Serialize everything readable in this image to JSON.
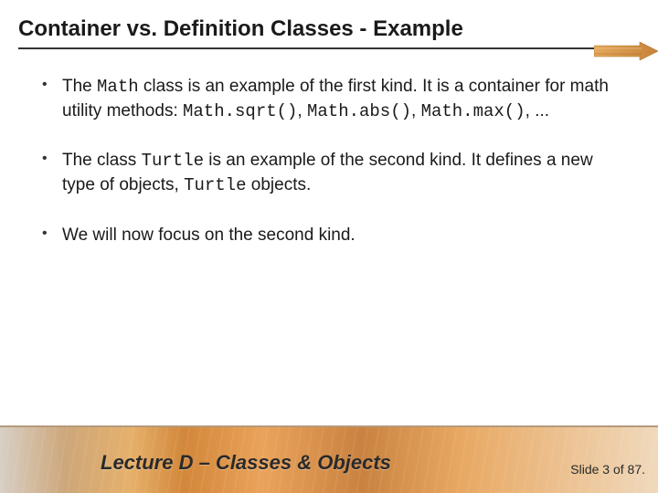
{
  "title": "Container vs. Definition Classes - Example",
  "bullets": [
    {
      "pre1": "The ",
      "code1": "Math",
      "mid1": " class is an example of the first kind. It is a container for math utility methods: ",
      "code2": "Math.sqrt()",
      "mid2": ", ",
      "code3": "Math.abs()",
      "mid3": ", ",
      "code4": "Math.max()",
      "post": ", ..."
    },
    {
      "pre1": "The class ",
      "code1": "Turtle",
      "mid1": " is an example of the second kind. It defines a new type of objects, ",
      "code2": "Turtle",
      "post": " objects."
    },
    {
      "pre1": "We will now focus on the second kind."
    }
  ],
  "footer": {
    "lecture": "Lecture D – Classes & Objects",
    "slide_label": "Slide 3 of 87."
  }
}
